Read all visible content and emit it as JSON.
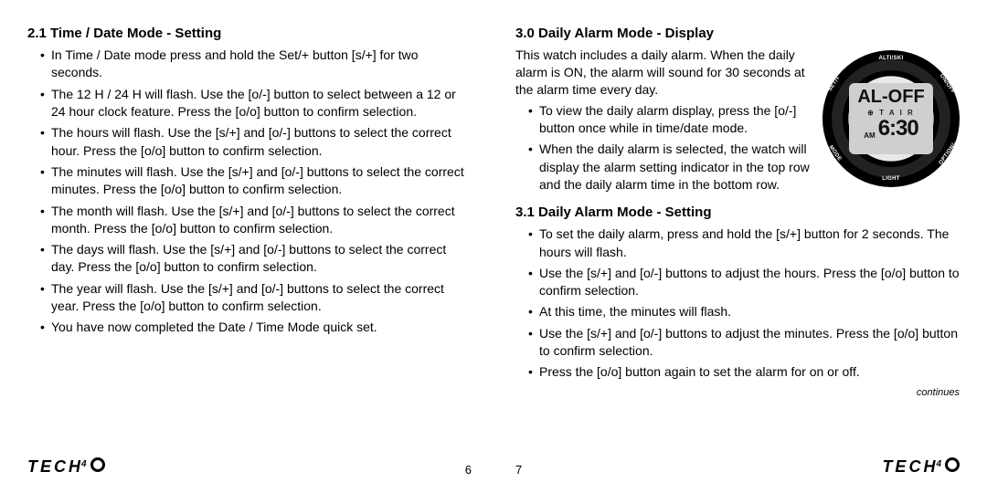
{
  "left": {
    "heading": "2.1 Time / Date Mode - Setting",
    "bullets": [
      "In Time / Date mode press and hold the Set/+ button [s/+] for two seconds.",
      "The 12 H / 24 H will flash. Use the [o/-] button to select between a 12 or 24 hour clock feature. Press the [o/o] button to confirm selection.",
      "The hours will flash. Use the [s/+] and [o/-] buttons to select the correct hour. Press the [o/o] button to confirm selection.",
      "The minutes will flash. Use the [s/+] and [o/-] buttons to select the correct minutes. Press the [o/o] button to confirm selection.",
      "The month will flash. Use the [s/+] and [o/-] buttons to select the correct month. Press the [o/o] button to confirm selection.",
      "The days will flash. Use the [s/+] and [o/-] buttons to select the correct day. Press the [o/o] button to confirm selection.",
      "The year will flash. Use the [s/+] and [o/-] buttons to select the correct year. Press the [o/o] button to confirm selection.",
      "You have now completed the Date / Time Mode quick set."
    ],
    "page_number": "6"
  },
  "right": {
    "heading1": "3.0 Daily Alarm Mode - Display",
    "intro": "This watch includes a daily alarm. When the daily alarm is ON, the alarm will sound for 30 seconds at the alarm time every day.",
    "bullets1": [
      "To view the daily alarm display, press the [o/-] button once while in time/date mode.",
      "When the daily alarm is selected, the watch will display the alarm setting indicator in the top row and the daily alarm time in the bottom row."
    ],
    "heading2": "3.1 Daily Alarm Mode - Setting",
    "bullets2": [
      "To set the daily alarm, press and hold the [s/+] button for 2 seconds. The hours will flash.",
      "Use the [s/+] and [o/-] buttons to adjust the hours. Press the [o/o] button to confirm selection.",
      "At this time, the minutes will flash.",
      "Use the [s/+] and [o/-] buttons to adjust the minutes. Press the [o/o] button to confirm selection.",
      "Press the [o/o] button again to set the alarm for on or off."
    ],
    "continues": "continues",
    "page_number": "7"
  },
  "watch": {
    "row1": "AL-OFF",
    "row2": "⊕ T A I R",
    "ampm": "AM",
    "time": "6:30",
    "bezel": {
      "top": "ALTI/SKI",
      "bottom": "LIGHT",
      "l1": "SET/+",
      "l2": "MODE",
      "r1": "ON/OFF",
      "r2": "OPTION/-"
    }
  },
  "brand": {
    "pre": "TECH",
    "sup": "4"
  }
}
